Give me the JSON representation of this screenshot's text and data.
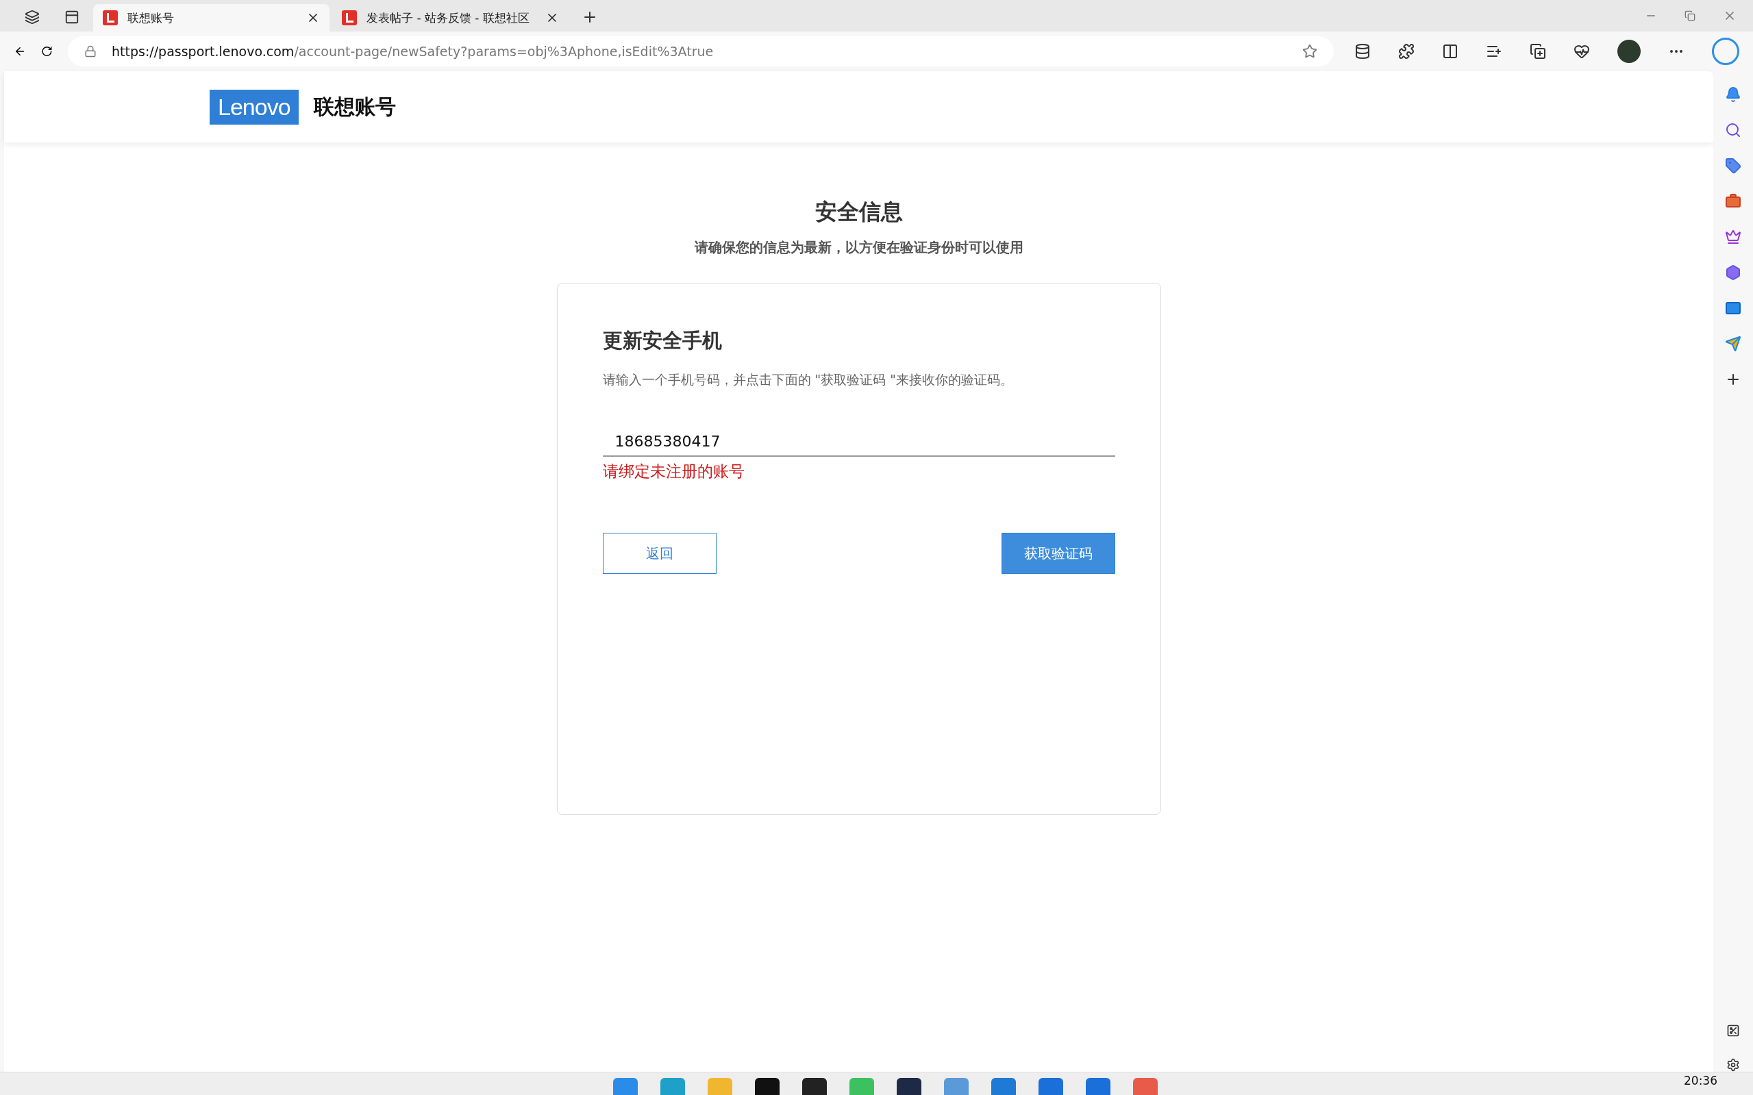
{
  "browser": {
    "tabs": [
      {
        "title": "联想账号",
        "selected": true
      },
      {
        "title": "发表帖子 - 站务反馈 - 联想社区",
        "selected": false
      }
    ],
    "url_host": "https://passport.lenovo.com",
    "url_path": "/account-page/newSafety?params=obj%3Aphone,isEdit%3Atrue"
  },
  "header": {
    "logo": "Lenovo",
    "title": "联想账号"
  },
  "page": {
    "title": "安全信息",
    "subtitle": "请确保您的信息为最新，以方便在验证身份时可以使用"
  },
  "card": {
    "heading": "更新安全手机",
    "description": "请输入一个手机号码，并点击下面的 \"获取验证码 \"来接收你的验证码。",
    "phone": "18685380417",
    "error": "请绑定未注册的账号",
    "back_button": "返回",
    "code_button": "获取验证码"
  },
  "taskbar": {
    "clock": "20:36"
  }
}
